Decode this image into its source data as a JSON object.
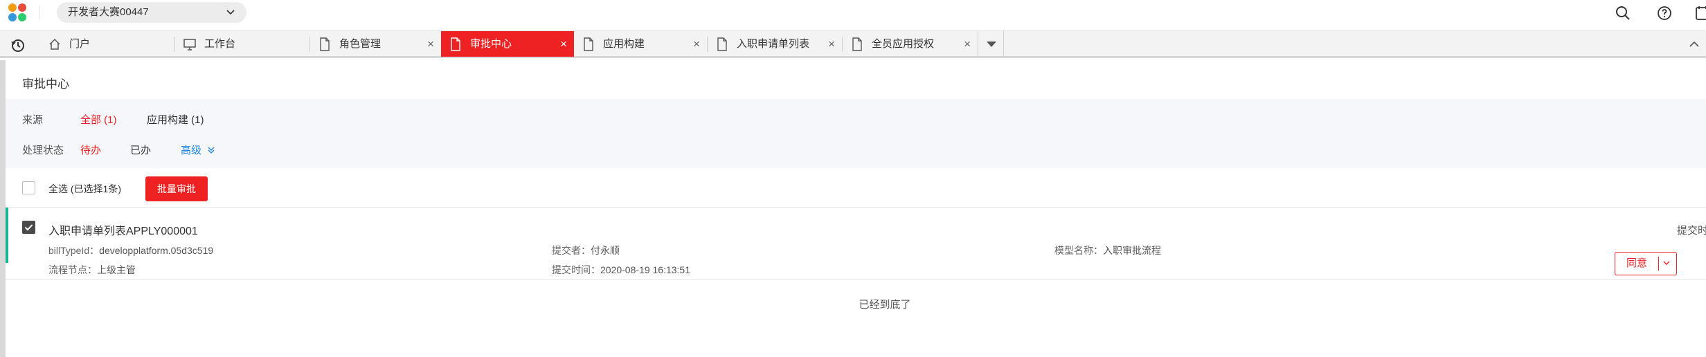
{
  "topbar": {
    "org_name": "开发者大赛00447",
    "icons": [
      "app-logo",
      "chevron-down-icon",
      "search-icon",
      "help-icon",
      "calendar-icon"
    ]
  },
  "tabs": [
    {
      "label": "门户",
      "icon": "home-icon",
      "closable": false,
      "active": false
    },
    {
      "label": "工作台",
      "icon": "monitor-icon",
      "closable": false,
      "active": false
    },
    {
      "label": "角色管理",
      "icon": "doc-icon",
      "closable": true,
      "active": false
    },
    {
      "label": "审批中心",
      "icon": "doc-icon",
      "closable": true,
      "active": true
    },
    {
      "label": "应用构建",
      "icon": "doc-icon",
      "closable": true,
      "active": false
    },
    {
      "label": "入职申请单列表",
      "icon": "doc-icon",
      "closable": true,
      "active": false
    },
    {
      "label": "全员应用授权",
      "icon": "doc-icon",
      "closable": true,
      "active": false
    }
  ],
  "page": {
    "title": "审批中心"
  },
  "filters": {
    "source_label": "来源",
    "source_options": [
      "全部 (1)",
      "应用构建 (1)"
    ],
    "status_label": "处理状态",
    "status_options": [
      "待办",
      "已办"
    ],
    "advanced": "高级"
  },
  "toolbar": {
    "select_all": "全选 (已选择1条)",
    "batch_approve": "批量审批"
  },
  "item": {
    "title": "入职申请单列表APPLY000001",
    "bill_type_key": "billTypeId：",
    "bill_type_val": "developplatform.05d3c519",
    "submitter_key": "提交者：",
    "submitter_val": "付永顺",
    "model_key": "模型名称：",
    "model_val": "入职审批流程",
    "node_key": "流程节点：",
    "node_val": "上级主管",
    "time_key": "提交时间：",
    "time_val": "2020-08-19 16:13:51",
    "submit_time_cut": "提交时",
    "agree": "同意"
  },
  "footer": {
    "end_text": "已经到底了"
  },
  "colors": {
    "accent_red": "#ee2223",
    "accent_blue": "#1e88e5",
    "accent_green": "#1ab394"
  }
}
